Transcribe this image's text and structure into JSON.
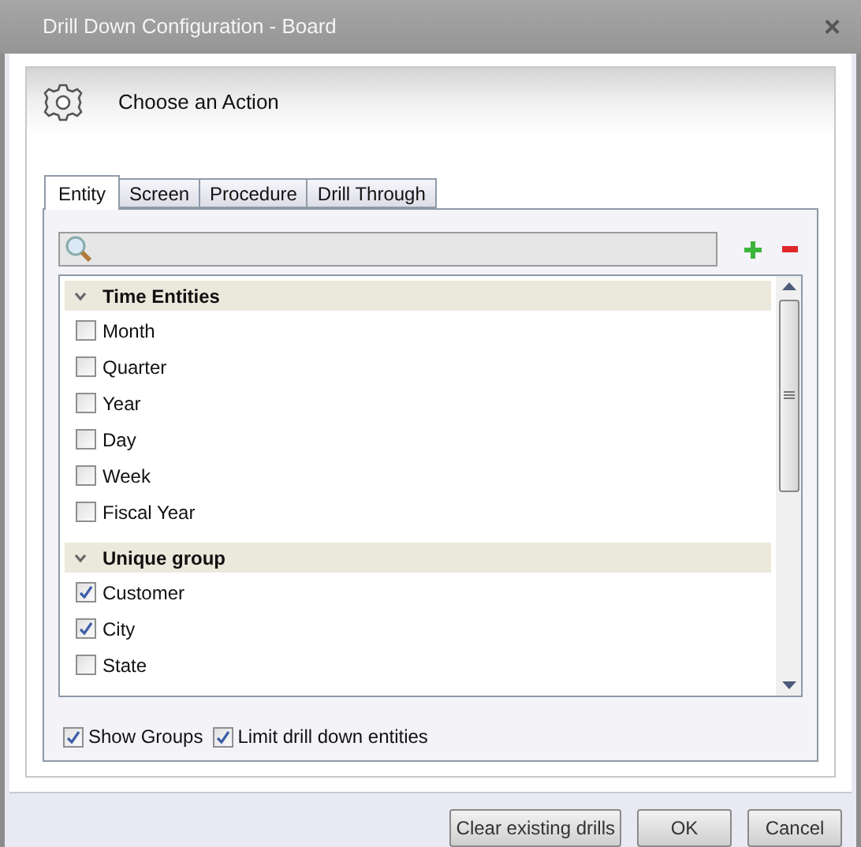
{
  "window": {
    "title": "Drill Down Configuration - Board",
    "close": "×"
  },
  "header": {
    "title": "Choose an Action"
  },
  "tabs": [
    {
      "label": "Entity",
      "selected": true
    },
    {
      "label": "Screen",
      "selected": false
    },
    {
      "label": "Procedure",
      "selected": false
    },
    {
      "label": "Drill Through",
      "selected": false
    }
  ],
  "groups": [
    {
      "title": "Time Entities",
      "expanded": true,
      "items": [
        {
          "label": "Month",
          "checked": false
        },
        {
          "label": "Quarter",
          "checked": false
        },
        {
          "label": "Year",
          "checked": false
        },
        {
          "label": "Day",
          "checked": false
        },
        {
          "label": "Week",
          "checked": false
        },
        {
          "label": "Fiscal Year",
          "checked": false
        }
      ]
    },
    {
      "title": "Unique group",
      "expanded": true,
      "items": [
        {
          "label": "Customer",
          "checked": true
        },
        {
          "label": "City",
          "checked": true
        },
        {
          "label": "State",
          "checked": false
        }
      ]
    }
  ],
  "options": [
    {
      "label": "Show Groups",
      "checked": true
    },
    {
      "label": "Limit drill down entities",
      "checked": true
    }
  ],
  "buttons": [
    "Clear existing drills",
    "OK",
    "Cancel"
  ]
}
